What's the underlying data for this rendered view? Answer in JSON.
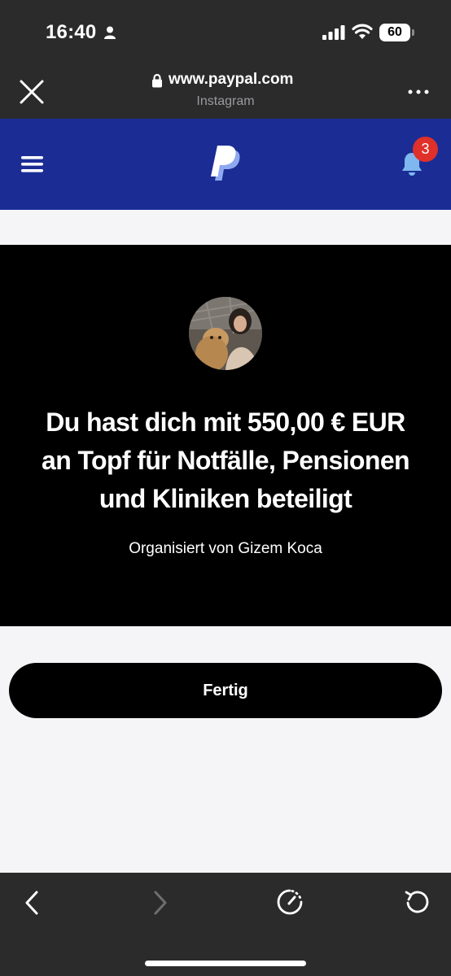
{
  "status_bar": {
    "time": "16:40",
    "battery": "60"
  },
  "browser": {
    "url": "www.paypal.com",
    "source_app": "Instagram"
  },
  "header": {
    "notification_count": "3"
  },
  "confirmation": {
    "headline_lines": [
      "Du hast dich mit 550,00 € EUR",
      "an Topf für Notfälle, Pensionen",
      "und Kliniken beteiligt"
    ],
    "organizer": "Organisiert von Gizem Koca"
  },
  "actions": {
    "done_label": "Fertig"
  },
  "colors": {
    "paypal_blue": "#1b2d94",
    "badge_red": "#e0302a",
    "chrome": "#2b2b2c"
  }
}
